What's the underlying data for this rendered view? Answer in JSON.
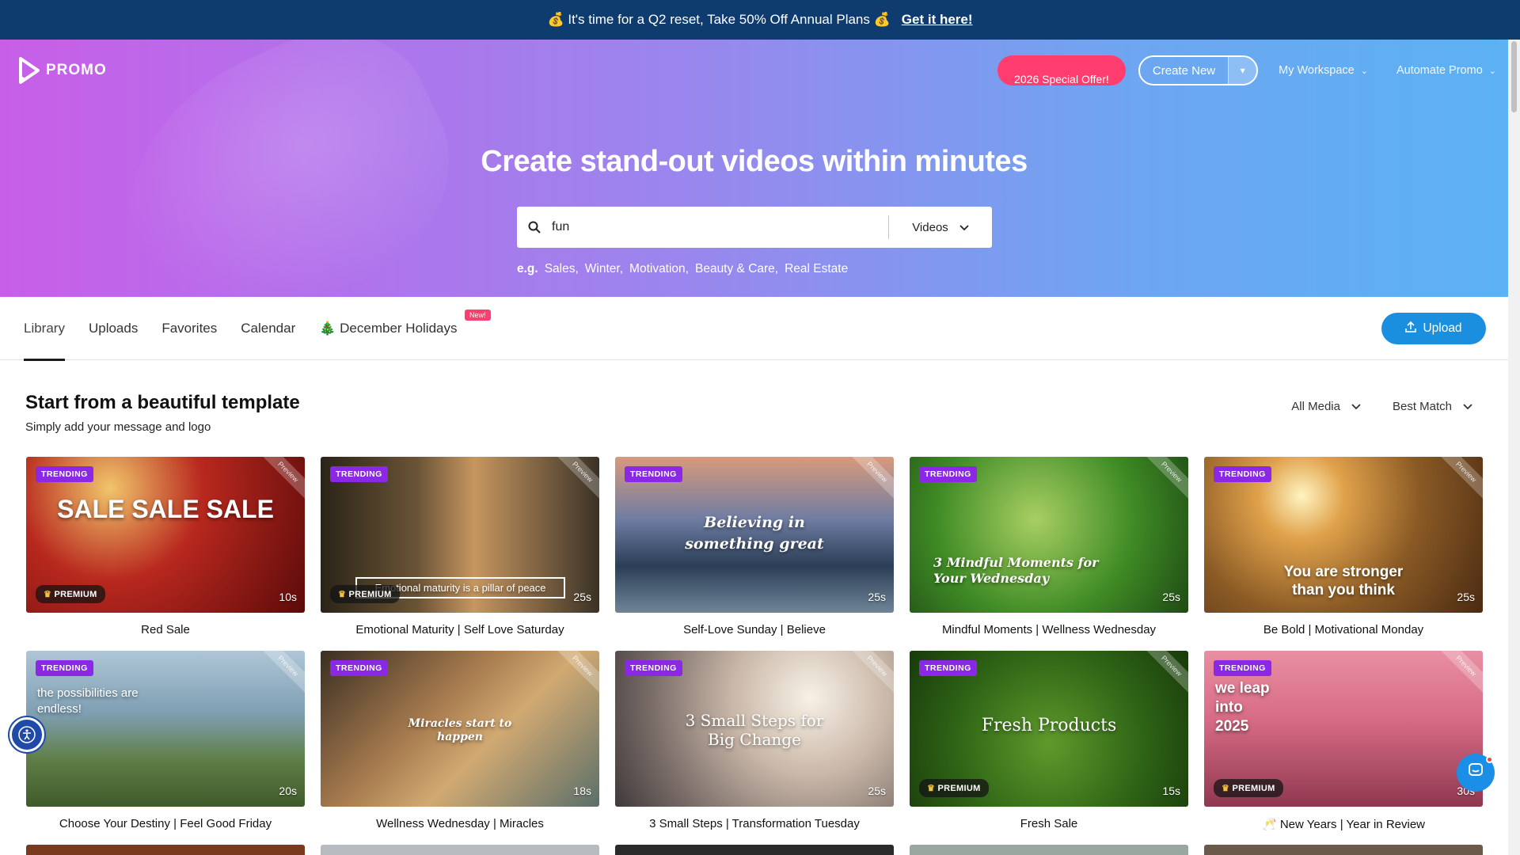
{
  "promo_bar": {
    "message": "💰 It's time for a Q2 reset, Take 50% Off Annual Plans 💰",
    "cta": "Get it here!"
  },
  "header": {
    "logo_text": "PROMO",
    "offer_button": "2026 Special Offer!",
    "create_new": "Create New",
    "my_workspace": "My Workspace",
    "automate_promo": "Automate Promo"
  },
  "hero": {
    "title": "Create stand-out videos within minutes",
    "search_value": "fun",
    "search_type": "Videos",
    "examples_prefix": "e.g.",
    "examples": [
      "Sales,",
      "Winter,",
      "Motivation,",
      "Beauty & Care,",
      "Real Estate"
    ]
  },
  "tabs": {
    "library": "Library",
    "uploads": "Uploads",
    "favorites": "Favorites",
    "calendar": "Calendar",
    "holidays": "🎄 December Holidays",
    "new_badge": "New!",
    "upload_button": "Upload"
  },
  "section": {
    "title": "Start from a beautiful template",
    "subtitle": "Simply add your message and logo",
    "filter_media": "All Media",
    "filter_sort": "Best Match"
  },
  "labels": {
    "trending": "TRENDING",
    "premium": "PREMIUM",
    "preview": "Preview"
  },
  "cards": [
    {
      "title": "Red Sale",
      "duration": "10s",
      "overlay": "SALE SALE SALE"
    },
    {
      "title": "Emotional Maturity | Self Love Saturday",
      "duration": "25s",
      "overlay": "Emotional maturity is a pillar of peace"
    },
    {
      "title": "Self-Love Sunday | Believe",
      "duration": "25s",
      "overlay": "Believing in something great"
    },
    {
      "title": "Mindful Moments | Wellness Wednesday",
      "duration": "25s",
      "overlay": "3 Mindful Moments for Your Wednesday"
    },
    {
      "title": "Be Bold | Motivational Monday",
      "duration": "25s",
      "overlay": "You are stronger than you think"
    },
    {
      "title": "Choose Your Destiny | Feel Good Friday",
      "duration": "20s",
      "overlay": "the possibilities are endless!"
    },
    {
      "title": "Wellness Wednesday | Miracles",
      "duration": "18s",
      "overlay": "Miracles start to happen"
    },
    {
      "title": "3 Small Steps | Transformation Tuesday",
      "duration": "25s",
      "overlay": "3 Small Steps for Big Change"
    },
    {
      "title": "Fresh Sale",
      "duration": "15s",
      "overlay": "Fresh Products"
    },
    {
      "title": "🥂 New Years | Year in Review",
      "duration": "30s",
      "overlay": "we leap into 2025"
    }
  ]
}
